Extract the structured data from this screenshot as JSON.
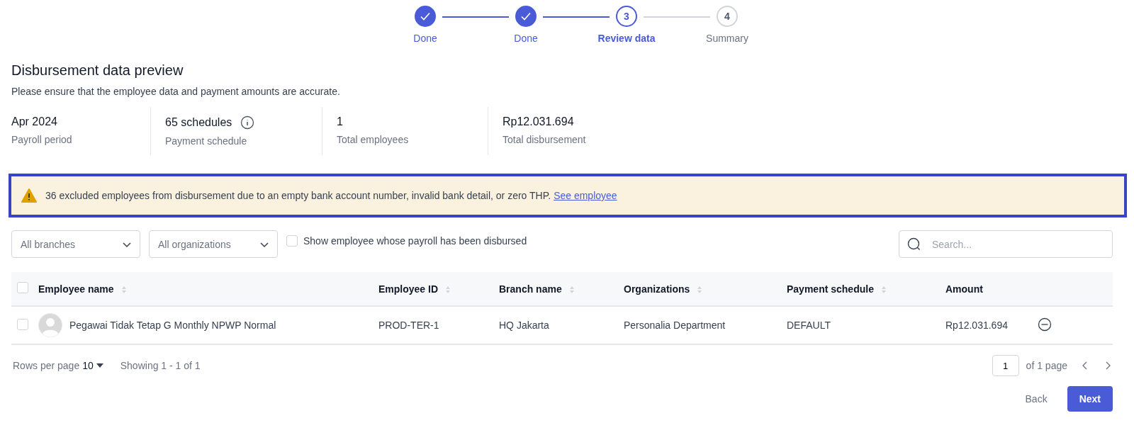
{
  "stepper": [
    {
      "label": "Done",
      "done": true,
      "selected": false
    },
    {
      "label": "Done",
      "done": true,
      "selected": false
    },
    {
      "marker": "3",
      "label": "Review data",
      "done": false,
      "selected": true
    },
    {
      "marker": "4",
      "label": "Summary",
      "done": false,
      "selected": false
    }
  ],
  "header": {
    "title": "Disbursement data preview",
    "subtitle": "Please ensure that the employee data and payment amounts are accurate."
  },
  "stats": [
    {
      "value": "Apr 2024",
      "label": "Payroll period",
      "info": false
    },
    {
      "value": "65 schedules",
      "label": "Payment schedule",
      "info": true
    },
    {
      "value": "1",
      "label": "Total employees",
      "info": false
    },
    {
      "value": "Rp12.031.694",
      "label": "Total disbursement",
      "info": false
    }
  ],
  "alert": {
    "message": "36 excluded employees from disbursement due to an empty bank account number, invalid bank detail, or zero THP.",
    "link": "See employee"
  },
  "filters": {
    "dropdowns": [
      "All branches",
      "All organizations"
    ],
    "checkbox": {
      "label": "Show employee whose payroll has been disbursed",
      "checked": false
    },
    "search": {
      "placeholder": "Search..."
    }
  },
  "table": {
    "select_all_checked": false,
    "columns": [
      {
        "label": "Employee name",
        "sortable": true
      },
      {
        "label": "Employee ID",
        "sortable": true
      },
      {
        "label": "Branch name",
        "sortable": true
      },
      {
        "label": "Organizations",
        "sortable": true
      },
      {
        "label": "Payment schedule",
        "sortable": true
      },
      {
        "label": "Amount",
        "sortable": false
      }
    ],
    "rows": [
      {
        "checked": false,
        "cells": [
          "Pegawai Tidak Tetap G Monthly NPWP Normal",
          "PROD-TER-1",
          "HQ Jakarta",
          "Personalia Department",
          "DEFAULT",
          "Rp12.031.694"
        ]
      }
    ]
  },
  "pagination": {
    "rows_per_page_label": "Rows per page",
    "rows_per_page": "10",
    "showing": "Showing 1 - 1 of 1",
    "page": "1",
    "of_pages": "of 1 page"
  },
  "buttons": {
    "back": "Back",
    "next": "Next"
  }
}
